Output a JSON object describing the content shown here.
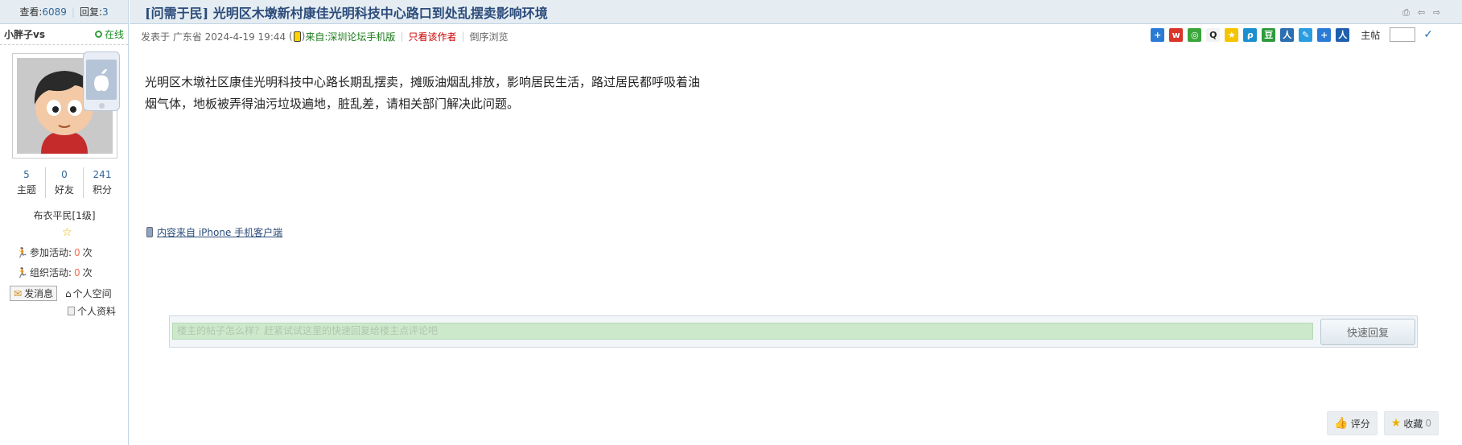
{
  "stats": {
    "views_label": "查看:",
    "views": "6089",
    "replies_label": "回复:",
    "replies": "3"
  },
  "author": {
    "name": "小胖子vs",
    "status": "在线",
    "counts": [
      {
        "value": "5",
        "label": "主题"
      },
      {
        "value": "0",
        "label": "好友"
      },
      {
        "value": "241",
        "label": "积分"
      }
    ],
    "level": "布衣平民[1级]",
    "activity_join_label": "参加活动:",
    "activity_join_count": "0",
    "activity_org_label": "组织活动:",
    "activity_org_count": "0",
    "times_unit": "次",
    "send_message": "发消息",
    "personal_space": "个人空间",
    "personal_profile": "个人资料"
  },
  "post": {
    "title": "[问需于民] 光明区木墩新村康佳光明科技中心路口到处乱摆卖影响环境",
    "posted_prefix": "发表于 广东省 2024-4-19 19:44",
    "from_label": "来自:",
    "from_source": "深圳论坛手机版",
    "only_author": "只看该作者",
    "reverse_browse": "倒序浏览",
    "main_post_label": "主帖",
    "content_line1": "光明区木墩社区康佳光明科技中心路长期乱摆卖，摊贩油烟乱排放，影响居民生活，路过居民都呼吸着油",
    "content_line2": "烟气体，地板被弄得油污垃圾遍地，脏乱差，请相关部门解决此问题。",
    "source_note": "内容来自 iPhone 手机客户端"
  },
  "quick_reply": {
    "placeholder": "楼主的帖子怎么样？赶紧试试这里的快速回复给楼主点评论吧",
    "button": "快速回复"
  },
  "actions": {
    "rate": "评分",
    "favorite": "收藏",
    "favorite_count": "0"
  },
  "share_icons": [
    "add-icon",
    "weibo-icon",
    "wechat-icon",
    "qq-icon",
    "qzone-icon",
    "tencent-weibo-icon",
    "douban-icon",
    "renren-icon",
    "edit-icon",
    "plus-icon",
    "profile-icon"
  ],
  "colors": {
    "accent": "#2b4b7a",
    "header_bg": "#e5edf2",
    "border": "#c2d5e3",
    "reply_field": "#cce9cc"
  }
}
